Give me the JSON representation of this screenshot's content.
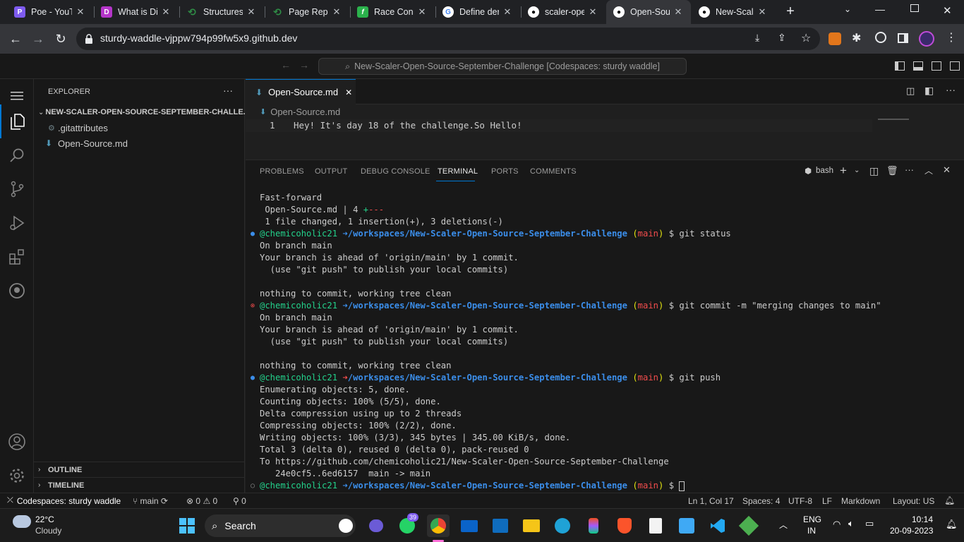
{
  "browser": {
    "tabs": [
      {
        "title": "Poe - YouT",
        "icon": "poe-icon",
        "color": "#7e5bef",
        "glyph": "P"
      },
      {
        "title": "What is Di",
        "icon": "d-icon",
        "color": "#b535c9",
        "glyph": "D"
      },
      {
        "title": "Structures",
        "icon": "gfg-icon",
        "color": "#2f8d46",
        "glyph": "G"
      },
      {
        "title": "Page Repla",
        "icon": "gfg-icon",
        "color": "#2f8d46",
        "glyph": "G"
      },
      {
        "title": "Race Cond",
        "icon": "feedly-icon",
        "color": "#2bb24c",
        "glyph": "f"
      },
      {
        "title": "Define der",
        "icon": "google-icon",
        "color": "#ffffff",
        "glyph": "G"
      },
      {
        "title": "scaler-ope",
        "icon": "github-icon",
        "color": "#ffffff",
        "glyph": "●"
      },
      {
        "title": "Open-Sour",
        "icon": "github-icon",
        "color": "#ffffff",
        "glyph": "●"
      },
      {
        "title": "New-Scale",
        "icon": "github-icon",
        "color": "#ffffff",
        "glyph": "●"
      }
    ],
    "new_tab": "+",
    "url": "sturdy-waddle-vjppw794p99fw5x9.github.dev"
  },
  "vscode": {
    "command_center": "New-Scaler-Open-Source-September-Challenge [Codespaces: sturdy waddle]",
    "explorer": {
      "title": "EXPLORER",
      "more": "···",
      "folder": "NEW-SCALER-OPEN-SOURCE-SEPTEMBER-CHALLE...",
      "files": [
        ".gitattributes",
        "Open-Source.md"
      ],
      "outline": "OUTLINE",
      "timeline": "TIMELINE"
    },
    "editor": {
      "tab": "Open-Source.md",
      "breadcrumb": "Open-Source.md",
      "line_number": "1",
      "line_text": "Hey! It's day 18 of the challenge.So Hello!"
    },
    "panel": {
      "tabs": [
        "PROBLEMS",
        "OUTPUT",
        "DEBUG CONSOLE",
        "TERMINAL",
        "PORTS",
        "COMMENTS"
      ],
      "active_tab": "TERMINAL",
      "shell": "bash"
    },
    "terminal": {
      "user": "@chemicoholic21",
      "path": "/workspaces/New-Scaler-Open-Source-September-Challenge",
      "branch": "main",
      "lines": [
        "Fast-forward",
        " Open-Source.md | 4 ",
        " 1 file changed, 1 insertion(+), 3 deletions(-)",
        "git status",
        "On branch main",
        "Your branch is ahead of 'origin/main' by 1 commit.",
        "  (use \"git push\" to publish your local commits)",
        "",
        "nothing to commit, working tree clean",
        "git commit -m \"merging changes to main\"",
        "On branch main",
        "Your branch is ahead of 'origin/main' by 1 commit.",
        "  (use \"git push\" to publish your local commits)",
        "",
        "nothing to commit, working tree clean",
        "git push",
        "Enumerating objects: 5, done.",
        "Counting objects: 100% (5/5), done.",
        "Delta compression using up to 2 threads",
        "Compressing objects: 100% (2/2), done.",
        "Writing objects: 100% (3/3), 345 bytes | 345.00 KiB/s, done.",
        "Total 3 (delta 0), reused 0 (delta 0), pack-reused 0",
        "To https://github.com/chemicoholic21/New-Scaler-Open-Source-September-Challenge",
        "   24e0cf5..6ed6157  main -> main"
      ],
      "diffstat_plus": "+",
      "diffstat_minus": "---"
    },
    "status": {
      "remote": "Codespaces: sturdy waddle",
      "branch": "main",
      "errors": "0",
      "warnings": "0",
      "ports": "0",
      "position": "Ln 1, Col 17",
      "spaces": "Spaces: 4",
      "encoding": "UTF-8",
      "eol": "LF",
      "language": "Markdown",
      "layout": "Layout: US"
    }
  },
  "taskbar": {
    "weather_temp": "22°C",
    "weather_text": "Cloudy",
    "search": "Search",
    "whatsapp_badge": "39",
    "lang1": "ENG",
    "lang2": "IN",
    "time": "10:14",
    "date": "20-09-2023"
  }
}
